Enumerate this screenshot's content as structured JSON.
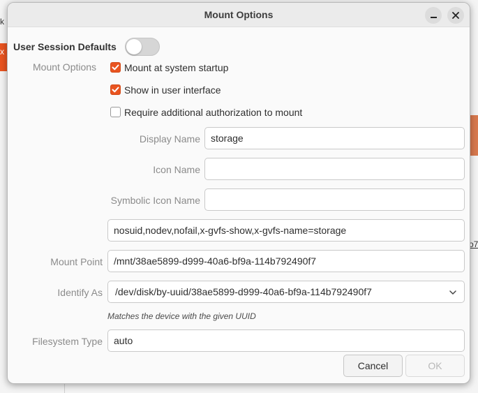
{
  "dialog": {
    "title": "Mount Options"
  },
  "session": {
    "label": "User Session Defaults",
    "toggle_on": false
  },
  "mount_options": {
    "section_label": "Mount Options",
    "startup_label": "Mount at system startup",
    "startup_checked": true,
    "ui_label": "Show in user interface",
    "ui_checked": true,
    "auth_label": "Require additional authorization to mount",
    "auth_checked": false
  },
  "fields": {
    "display_name_label": "Display Name",
    "display_name_value": "storage",
    "icon_name_label": "Icon Name",
    "icon_name_value": "",
    "symbolic_icon_label": "Symbolic Icon Name",
    "symbolic_icon_value": "",
    "options_value": "nosuid,nodev,nofail,x-gvfs-show,x-gvfs-name=storage",
    "mount_point_label": "Mount Point",
    "mount_point_value": "/mnt/38ae5899-d999-40a6-bf9a-114b792490f7",
    "identify_label": "Identify As",
    "identify_value": "/dev/disk/by-uuid/38ae5899-d999-40a6-bf9a-114b792490f7",
    "identify_hint": "Matches the device with the given UUID",
    "fstype_label": "Filesystem Type",
    "fstype_value": "auto"
  },
  "buttons": {
    "cancel": "Cancel",
    "ok": "OK"
  },
  "background": {
    "glyph_top": "k",
    "glyph_x": "x",
    "link_fragment": "o7"
  },
  "colors": {
    "accent": "#e95420"
  }
}
